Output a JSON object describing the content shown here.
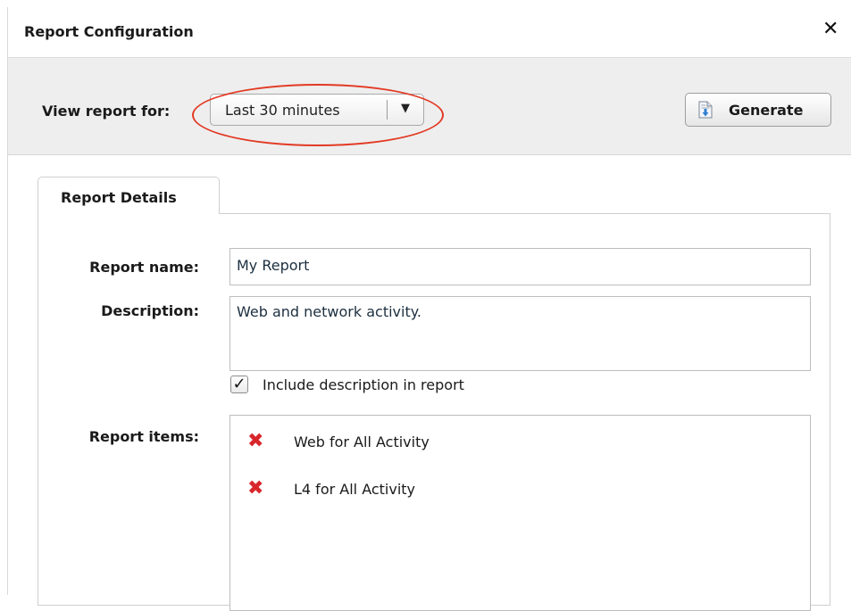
{
  "dialog": {
    "title": "Report Configuration",
    "close_icon": "close-icon"
  },
  "toolbar": {
    "view_label": "View report for:",
    "time_range": {
      "selected": "Last 30 minutes",
      "arrow_glyph": "▼"
    },
    "generate": {
      "label": "Generate",
      "icon": "document-download-icon"
    },
    "highlight_color": "#e23a24"
  },
  "tabs": [
    {
      "label": "Report Details",
      "active": true
    }
  ],
  "form": {
    "name_label": "Report name:",
    "name_value": "My Report",
    "description_label": "Description:",
    "description_value": "Web and network activity.",
    "include_description": {
      "checked": true,
      "check_glyph": "✓",
      "label": "Include description in report"
    },
    "items_label": "Report items:",
    "items": [
      {
        "label": "Web for All Activity",
        "remove_glyph": "✖"
      },
      {
        "label": "L4 for All Activity",
        "remove_glyph": "✖"
      }
    ]
  }
}
